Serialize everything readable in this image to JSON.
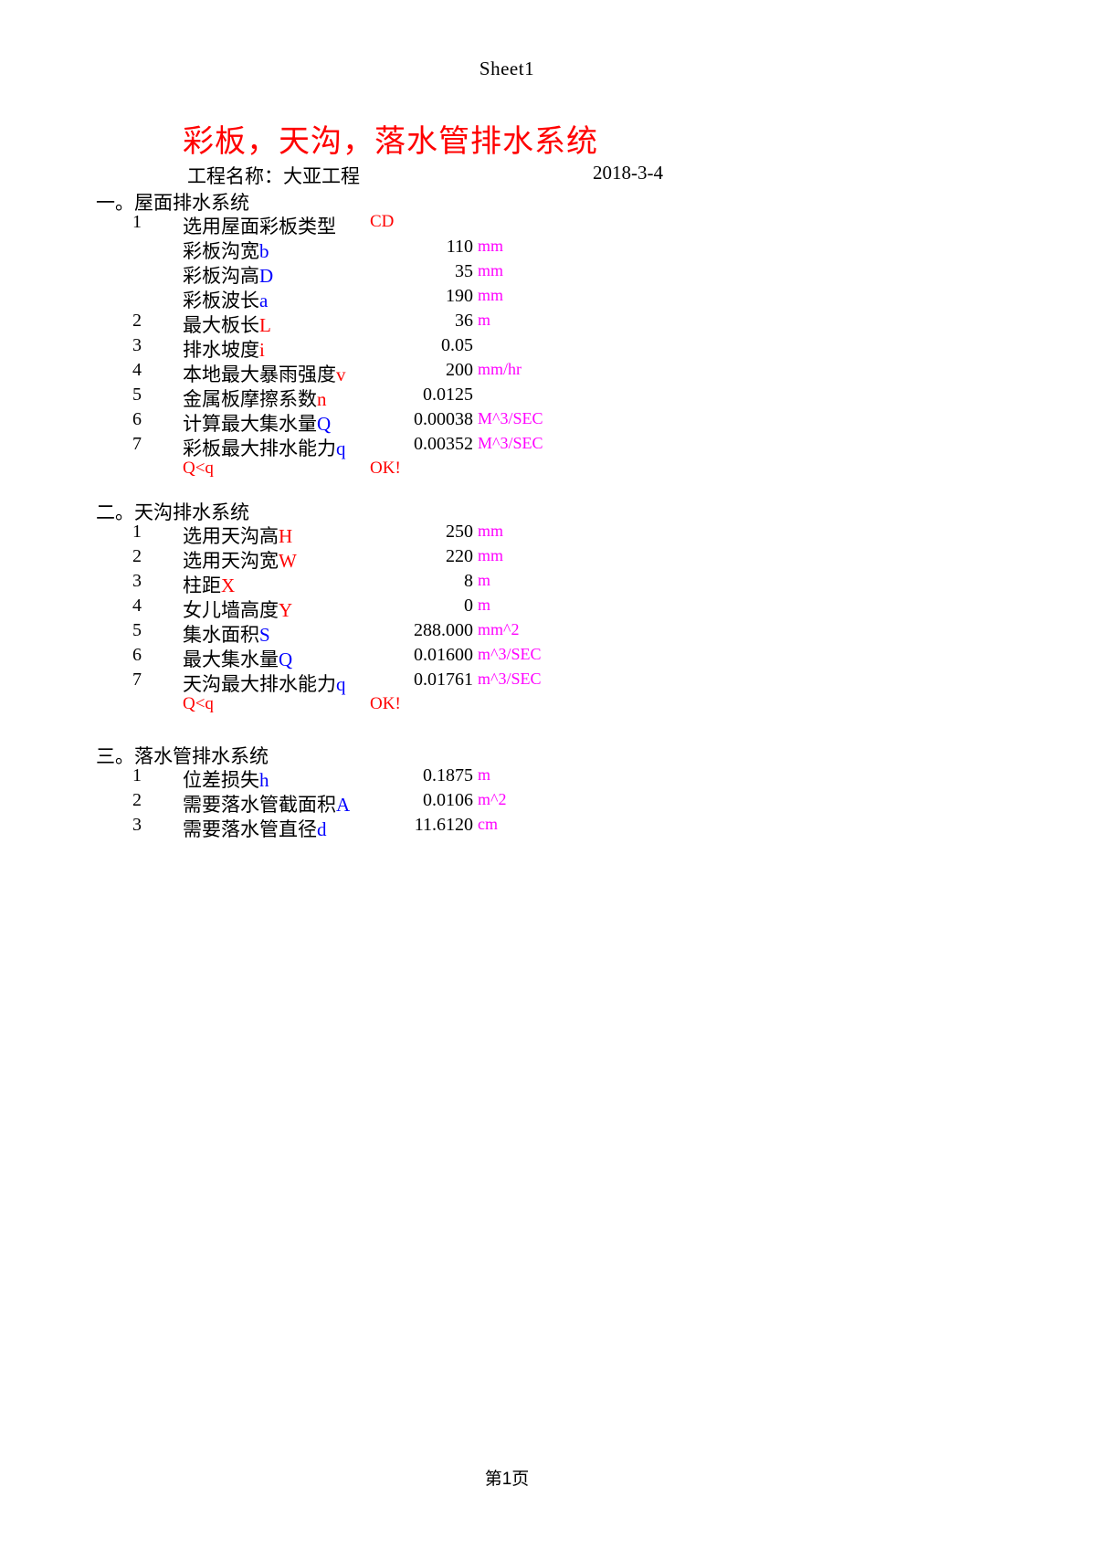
{
  "sheet": {
    "header": "Sheet1",
    "footer": "第1页"
  },
  "title": "彩板，天沟，落水管排水系统",
  "project": {
    "name": "工程名称：大亚工程",
    "date": "2018-3-4"
  },
  "colors": {
    "title": "#ff0000",
    "unit": "#ff00ff",
    "input_var": "#ff0000",
    "output_var": "#0000ff",
    "check": "#ff0000"
  },
  "sections": [
    {
      "heading": "一。屋面排水系统",
      "rows": [
        {
          "idx": "1",
          "label_text": "选用屋面彩板类型",
          "var": "",
          "var_color": "",
          "value": "",
          "unit": "",
          "textval": "CD"
        },
        {
          "idx": "",
          "label_text": "彩板沟宽",
          "var": "b",
          "var_color": "blue",
          "value": "110",
          "unit": "mm",
          "textval": ""
        },
        {
          "idx": "",
          "label_text": "彩板沟高",
          "var": "D",
          "var_color": "blue",
          "value": "35",
          "unit": "mm",
          "textval": ""
        },
        {
          "idx": "",
          "label_text": "彩板波长",
          "var": "a",
          "var_color": "blue",
          "value": "190",
          "unit": "mm",
          "textval": ""
        },
        {
          "idx": "2",
          "label_text": "最大板长",
          "var": "L",
          "var_color": "red",
          "value": "36",
          "unit": "m",
          "textval": ""
        },
        {
          "idx": "3",
          "label_text": "排水坡度",
          "var": "i",
          "var_color": "red",
          "value": "0.05",
          "unit": "",
          "textval": ""
        },
        {
          "idx": "4",
          "label_text": "本地最大暴雨强度",
          "var": "v",
          "var_color": "red",
          "value": "200",
          "unit": "mm/hr",
          "textval": ""
        },
        {
          "idx": "5",
          "label_text": "金属板摩擦系数",
          "var": "n",
          "var_color": "red",
          "value": "0.0125",
          "unit": "",
          "textval": ""
        },
        {
          "idx": "6",
          "label_text": "计算最大集水量",
          "var": "Q",
          "var_color": "blue",
          "value": "0.00038",
          "unit": "M^3/SEC",
          "textval": ""
        },
        {
          "idx": "7",
          "label_text": "彩板最大排水能力",
          "var": "q",
          "var_color": "blue",
          "value": "0.00352",
          "unit": "M^3/SEC",
          "textval": ""
        }
      ],
      "check": {
        "condition": "Q<q",
        "verdict": "OK!"
      }
    },
    {
      "heading": "二。天沟排水系统",
      "rows": [
        {
          "idx": "1",
          "label_text": "选用天沟高",
          "var": "H",
          "var_color": "red",
          "value": "250",
          "unit": "mm",
          "textval": ""
        },
        {
          "idx": "2",
          "label_text": "选用天沟宽",
          "var": "W",
          "var_color": "red",
          "value": "220",
          "unit": "mm",
          "textval": ""
        },
        {
          "idx": "3",
          "label_text": "柱距",
          "var": "X",
          "var_color": "red",
          "value": "8",
          "unit": "m",
          "textval": ""
        },
        {
          "idx": "4",
          "label_text": "女儿墙高度",
          "var": "Y",
          "var_color": "red",
          "value": "0",
          "unit": "m",
          "textval": ""
        },
        {
          "idx": "5",
          "label_text": "集水面积",
          "var": "S",
          "var_color": "blue",
          "value": "288.000",
          "unit": "mm^2",
          "textval": ""
        },
        {
          "idx": "6",
          "label_text": "最大集水量",
          "var": "Q",
          "var_color": "blue",
          "value": "0.01600",
          "unit": "m^3/SEC",
          "textval": ""
        },
        {
          "idx": "7",
          "label_text": "天沟最大排水能力",
          "var": "q",
          "var_color": "blue",
          "value": "0.01761",
          "unit": "m^3/SEC",
          "textval": ""
        }
      ],
      "check": {
        "condition": "Q<q",
        "verdict": "OK!"
      }
    },
    {
      "heading": "三。落水管排水系统",
      "rows": [
        {
          "idx": "1",
          "label_text": "位差损失",
          "var": "h",
          "var_color": "blue",
          "value": "0.1875",
          "unit": "m",
          "textval": ""
        },
        {
          "idx": "2",
          "label_text": "需要落水管截面积",
          "var": "A",
          "var_color": "blue",
          "value": "0.0106",
          "unit": "m^2",
          "textval": ""
        },
        {
          "idx": "3",
          "label_text": "需要落水管直径",
          "var": "d",
          "var_color": "blue",
          "value": "11.6120",
          "unit": "cm",
          "textval": ""
        }
      ],
      "check": null
    }
  ]
}
